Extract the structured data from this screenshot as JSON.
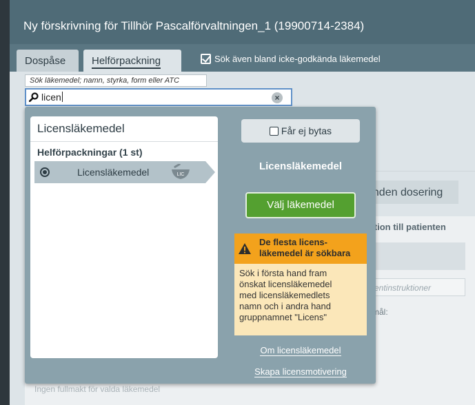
{
  "window": {
    "title": "Ny förskrivning för Tillhör Pascalförvaltningen_1 (19900714-2384)"
  },
  "tabs": [
    {
      "label": "Dospåse",
      "active": false
    },
    {
      "label": "Helförpackning",
      "active": true
    }
  ],
  "options": {
    "include_unapproved_label": "Sök även bland icke-godkända läkemedel",
    "include_unapproved_checked": true
  },
  "search": {
    "tooltip": "Sök läkemedel; namn, styrka, form eller ATC",
    "value": "licen",
    "search_icon": "magnifier-icon",
    "clear_icon": "clear-icon",
    "clear_symbol": "×"
  },
  "results": {
    "title": "Licensläkemedel",
    "group_header": "Helförpackningar (1 st)",
    "items": [
      {
        "label": "Licensläkemedel",
        "badge": "LIC",
        "selected": true
      }
    ]
  },
  "detail": {
    "not_substitutable_label": "Får ej bytas",
    "title": "Licensläkemedel",
    "select_button": "Välj läkemedel",
    "warning": {
      "title_line1": "De flesta licens-",
      "title_line2": "läkemedel är sökbara",
      "body_lines": [
        "Sök i första hand fram",
        "önskat licensläkemedel",
        "med licensläkemedlets",
        "namn och i andra hand",
        "gruppnamnet \"Licens\""
      ],
      "icon": "warning-icon"
    },
    "link_about": "Om licensläkemedel",
    "link_create": "Skapa licensmotivering"
  },
  "background": {
    "dosering_tab": "unden dosering",
    "info_label": "mation till patienten",
    "instr_placeholder": "entinstruktioner",
    "mal_label": "mål:",
    "faded_text": "Ingen fullmakt för valda läkemedel"
  },
  "colors": {
    "titlebar": "#4f6b77",
    "dropdown": "#8aa2ac",
    "accent_green": "#54a030",
    "warning_orange": "#f3a21c",
    "warning_bg": "#fbe7b9",
    "search_border": "#5f90c8"
  }
}
